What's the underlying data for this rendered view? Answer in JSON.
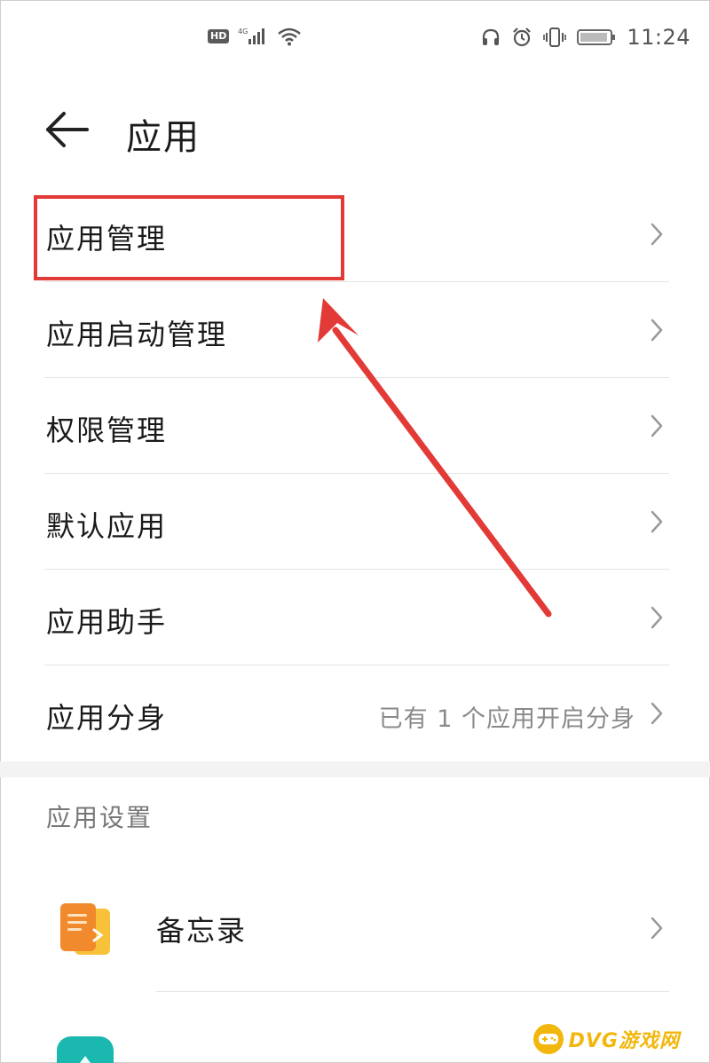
{
  "status_bar": {
    "network_badge": "HD",
    "signal_label": "4G",
    "time": "11:24",
    "icons": [
      "hd-icon",
      "signal-icon",
      "wifi-icon",
      "headset-icon",
      "alarm-icon",
      "vibrate-icon",
      "battery-icon"
    ]
  },
  "header": {
    "back_icon": "arrow-left-icon",
    "title": "应用"
  },
  "menu": {
    "items": [
      {
        "label": "应用管理",
        "value": ""
      },
      {
        "label": "应用启动管理",
        "value": ""
      },
      {
        "label": "权限管理",
        "value": ""
      },
      {
        "label": "默认应用",
        "value": ""
      },
      {
        "label": "应用助手",
        "value": ""
      },
      {
        "label": "应用分身",
        "value": "已有 1 个应用开启分身"
      }
    ]
  },
  "app_settings": {
    "section_title": "应用设置",
    "apps": [
      {
        "label": "备忘录",
        "icon": "notepad-icon",
        "color": "#f39a2e"
      },
      {
        "label": "",
        "icon": "teal-app-icon",
        "color": "#1bb8b0"
      }
    ]
  },
  "annotation": {
    "highlight_color": "#e23a36",
    "arrow_color": "#e23a36"
  },
  "watermark": {
    "text": "DVG游戏网"
  }
}
